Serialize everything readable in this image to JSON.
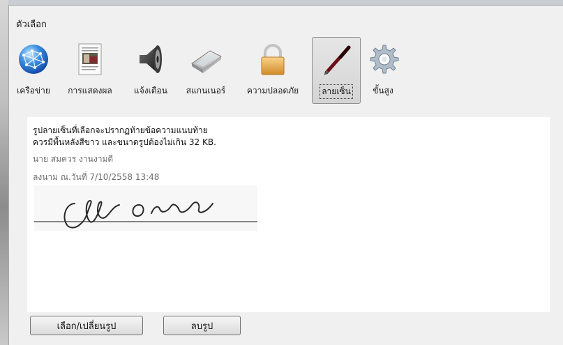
{
  "window": {
    "title": "ตัวเลือก"
  },
  "toolbar": {
    "items": [
      {
        "label": "เครือข่าย"
      },
      {
        "label": "การแสดงผล"
      },
      {
        "label": "แจ้งเตือน"
      },
      {
        "label": "สแกนเนอร์"
      },
      {
        "label": "ความปลอดภัย"
      },
      {
        "label": "ลายเซ็น",
        "selected": true
      },
      {
        "label": "ขั้นสูง"
      }
    ]
  },
  "signature": {
    "instruction_line1": "รูปลายเซ็นที่เลือกจะปรากฏท้ายข้อความแนบท้าย",
    "instruction_line2": "ควรมีพื้นหลังสีขาว และขนาดรูปต้องไม่เกิน 32 KB.",
    "name": "นาย สมควร งานงามดี",
    "signed_at": "ลงนาม ณ.วันที่ 7/10/2558 13:48"
  },
  "buttons": {
    "choose_label": "เลือก/เปลี่ยนรูป",
    "delete_label": "ลบรูป"
  },
  "icons": {
    "network": "globe-network-icon",
    "display": "document-image-icon",
    "notify": "speaker-icon",
    "scanner": "scanner-icon",
    "security": "padlock-icon",
    "signature": "fountain-pen-icon",
    "advanced": "gear-icon"
  }
}
